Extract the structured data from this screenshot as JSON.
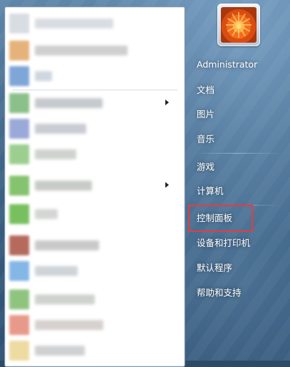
{
  "start_menu": {
    "user": {
      "avatar_icon": "flower-avatar-icon",
      "name": "Administrator"
    },
    "right_links": [
      {
        "label": "文档"
      },
      {
        "label": "图片"
      },
      {
        "label": "音乐"
      },
      {
        "label": "游戏"
      },
      {
        "label": "计算机"
      },
      {
        "label": "控制面板",
        "highlighted": true
      },
      {
        "label": "设备和打印机"
      },
      {
        "label": "默认程序"
      },
      {
        "label": "帮助和支持"
      }
    ],
    "programs_blurred": true,
    "highlight_color": "#e83b3b"
  }
}
